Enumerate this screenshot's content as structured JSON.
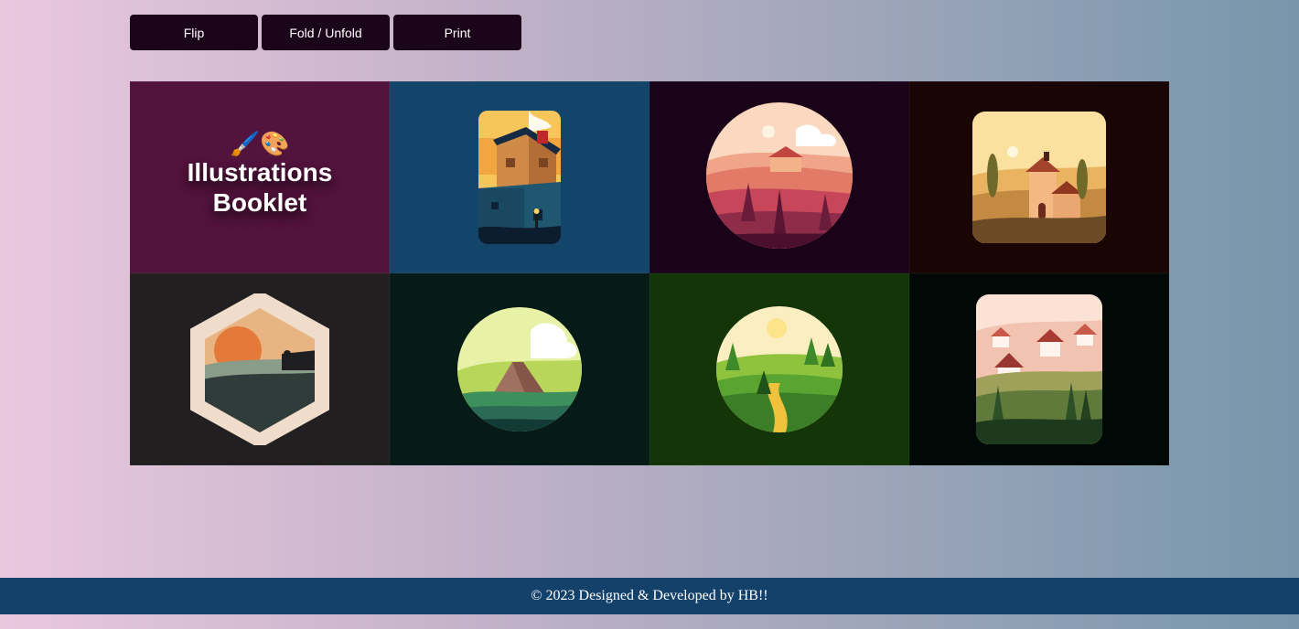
{
  "toolbar": {
    "buttons": [
      {
        "label": "Flip"
      },
      {
        "label": "Fold / Unfold"
      },
      {
        "label": "Print"
      }
    ]
  },
  "booklet": {
    "cover": {
      "emoji": "🖌️🎨",
      "title_line1": "Illustrations",
      "title_line2": "Booklet"
    },
    "pages": [
      {
        "name": "cover-page",
        "background": "#52133c"
      },
      {
        "name": "house-illustration",
        "background": "#13446a"
      },
      {
        "name": "sunset-hills-illustration",
        "background": "#1a0218"
      },
      {
        "name": "tuscan-villa-illustration",
        "background": "#190503"
      },
      {
        "name": "hexagon-sunset-illustration",
        "background": "#221f20"
      },
      {
        "name": "volcano-illustration",
        "background": "#061a18"
      },
      {
        "name": "green-fields-illustration",
        "background": "#133508"
      },
      {
        "name": "village-illustration",
        "background": "#010907"
      }
    ]
  },
  "footer": {
    "text": "© 2023 Designed & Developed by HB!!"
  }
}
